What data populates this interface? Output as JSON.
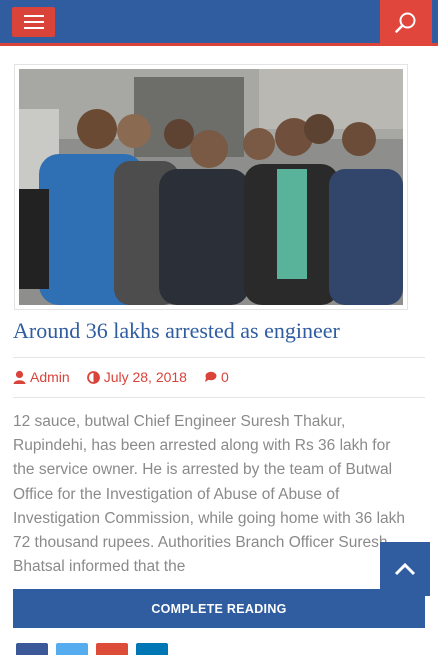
{
  "header": {
    "menu_icon": "hamburger-menu-icon",
    "search_icon": "search-icon",
    "colors": {
      "bar": "#2f5da0",
      "accent": "#d9433a"
    }
  },
  "post": {
    "image_icon": "news-photo",
    "title": "Around 36 lakhs arrested as engineer",
    "meta": {
      "author": "Admin",
      "date": "July 28, 2018",
      "comments": "0"
    },
    "excerpt": "12 sauce, butwal Chief Engineer Suresh Thakur, Rupindehi, has been arrested along with Rs 36 lakh for the service owner. He is arrested by the team of Butwal Office for the Investigation of Abuse of Abuse of Investigation Commission, while going home with 36 lakh 72 thousand rupees. Authorities Branch Officer Suresh Bhatsal informed that the",
    "read_more": "COMPLETE READING"
  },
  "share": {
    "icons": [
      "facebook-icon",
      "twitter-icon",
      "google-plus-icon",
      "linkedin-icon"
    ],
    "colors": [
      "#3b5998",
      "#55acee",
      "#dd4b39",
      "#0077b5"
    ]
  },
  "scroll_top_icon": "chevron-up-icon"
}
